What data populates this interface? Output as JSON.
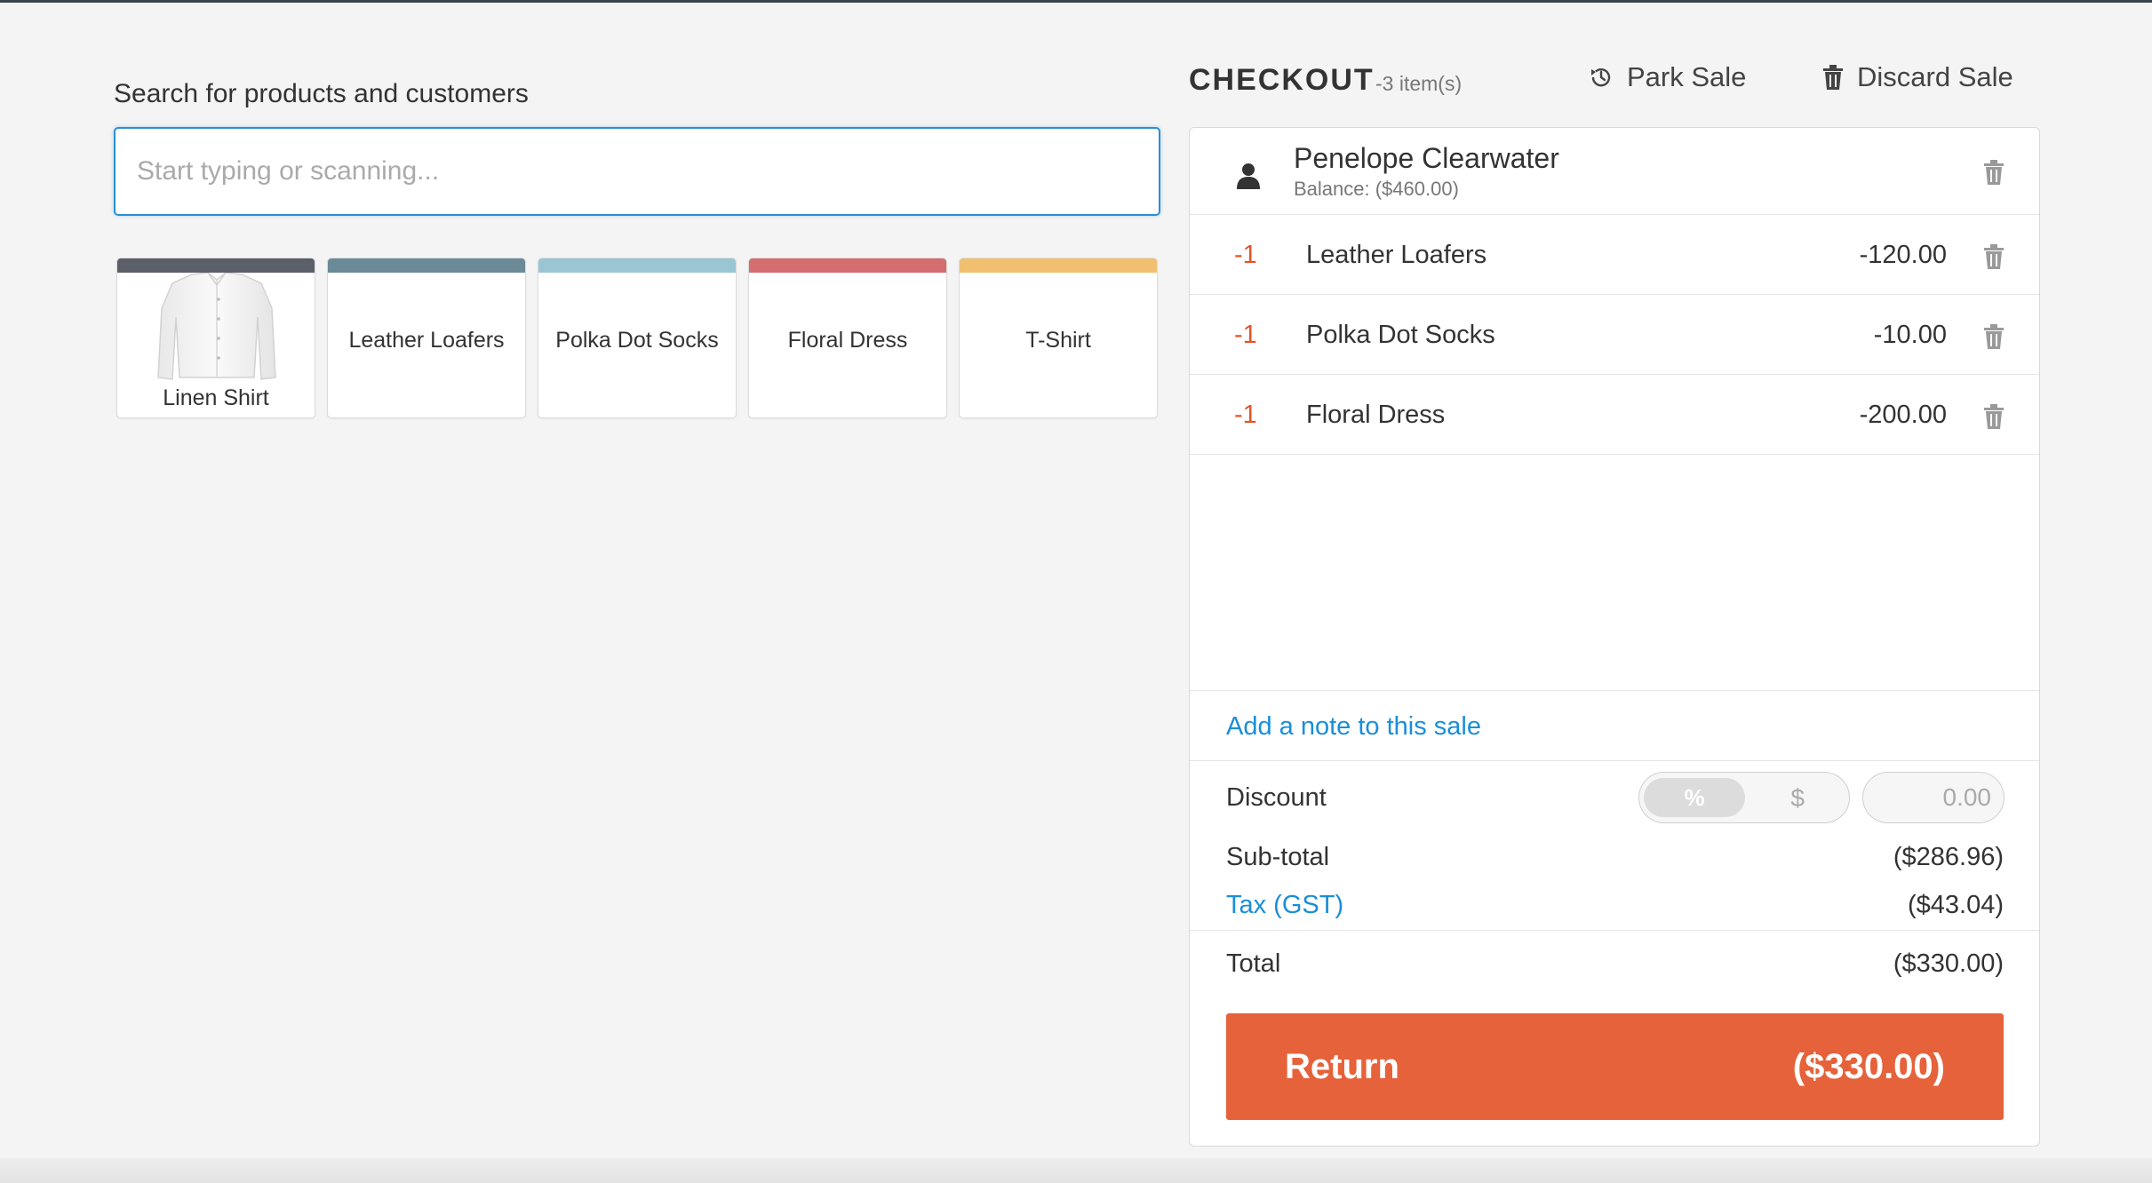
{
  "search": {
    "label": "Search for products and customers",
    "placeholder": "Start typing or scanning..."
  },
  "products": [
    {
      "name": "Linen Shirt",
      "color": "#5b6068"
    },
    {
      "name": "Leather Loafers",
      "color": "#6a8a97"
    },
    {
      "name": "Polka Dot Socks",
      "color": "#9ac6d4"
    },
    {
      "name": "Floral Dress",
      "color": "#d46d6d"
    },
    {
      "name": "T-Shirt",
      "color": "#f0c070"
    }
  ],
  "checkout": {
    "title": "CHECKOUT",
    "item_count": "-3 item(s)",
    "park_label": "Park Sale",
    "discard_label": "Discard Sale",
    "customer": {
      "name": "Penelope Clearwater",
      "balance": "Balance: ($460.00)"
    },
    "lines": [
      {
        "qty": "-1",
        "name": "Leather Loafers",
        "price": "-120.00"
      },
      {
        "qty": "-1",
        "name": "Polka Dot Socks",
        "price": "-10.00"
      },
      {
        "qty": "-1",
        "name": "Floral Dress",
        "price": "-200.00"
      }
    ],
    "note_link": "Add a note to this sale",
    "discount": {
      "label": "Discount",
      "percent": "%",
      "dollar": "$",
      "placeholder": "0.00"
    },
    "subtotal": {
      "label": "Sub-total",
      "value": "($286.96)"
    },
    "tax": {
      "label": "Tax (GST)",
      "value": "($43.04)"
    },
    "total": {
      "label": "Total",
      "value": "($330.00)"
    },
    "return_button": {
      "label": "Return",
      "amount": "($330.00)"
    }
  },
  "colors": {
    "accent": "#e5623a",
    "link": "#1a8ed8",
    "negative_qty": "#e5532b"
  }
}
